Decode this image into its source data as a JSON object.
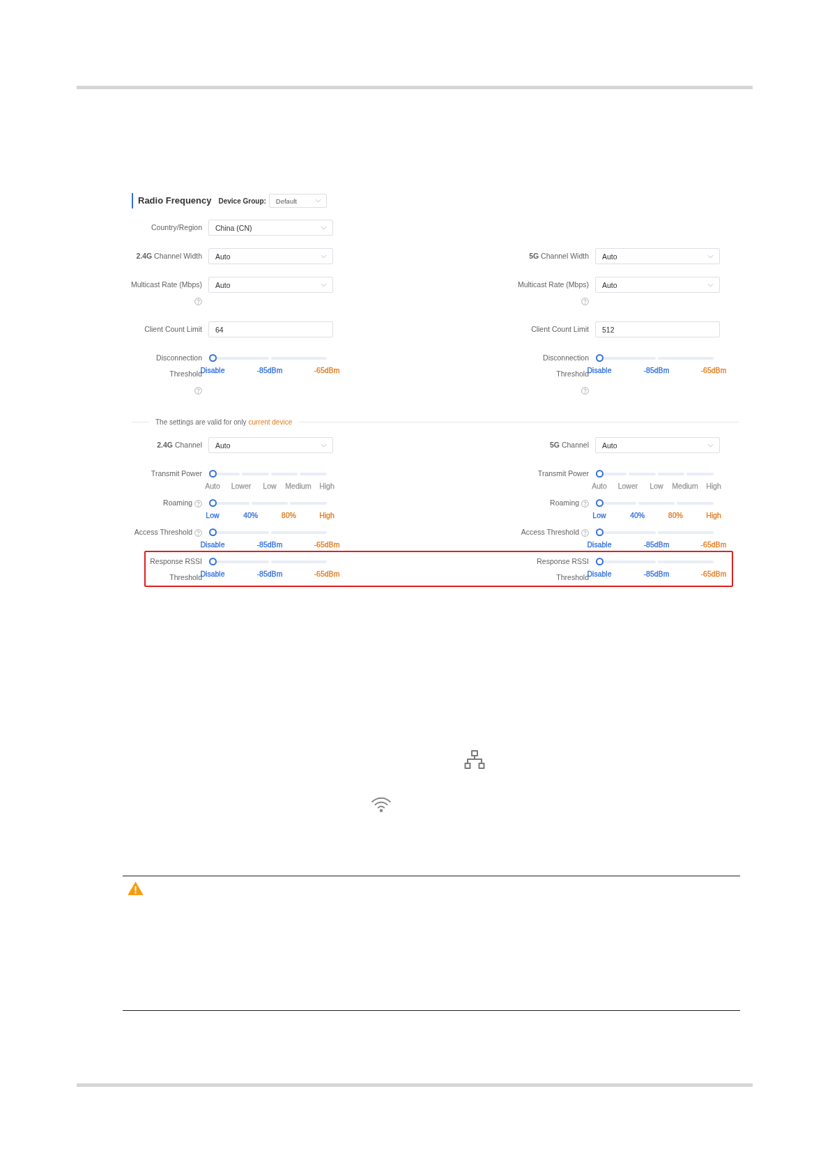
{
  "panel": {
    "title": "Radio Frequency",
    "device_group": {
      "label": "Device Group:",
      "value": "Default"
    }
  },
  "global_rows": [
    {
      "left": {
        "kind": "select",
        "label": "Country/Region",
        "value": "China (CN)"
      }
    },
    {
      "left": {
        "kind": "select",
        "label": "**2.4G** Channel Width",
        "value": "Auto"
      },
      "right": {
        "kind": "select",
        "label": "**5G** Channel Width",
        "value": "Auto"
      }
    },
    {
      "left": {
        "kind": "select",
        "label": "Multicast Rate (Mbps)",
        "value": "Auto",
        "help": true
      },
      "right": {
        "kind": "select",
        "label": "Multicast Rate (Mbps)",
        "value": "Auto",
        "help": true
      }
    },
    {
      "left": {
        "kind": "input",
        "label": "Client Count Limit",
        "value": "64"
      },
      "right": {
        "kind": "input",
        "label": "Client Count Limit",
        "value": "512"
      }
    },
    {
      "left": {
        "kind": "slider",
        "label": "Disconnection Threshold",
        "help": true,
        "level": 0,
        "ticks": [
          {
            "text": "Disable",
            "color": "#2f6fdc"
          },
          {
            "text": "-85dBm",
            "color": "#2f6fdc"
          },
          {
            "text": "-65dBm",
            "color": "#e07a1f"
          }
        ]
      },
      "right": {
        "kind": "slider",
        "label": "Disconnection Threshold",
        "help": true,
        "level": 0,
        "ticks": [
          {
            "text": "Disable",
            "color": "#2f6fdc"
          },
          {
            "text": "-85dBm",
            "color": "#2f6fdc"
          },
          {
            "text": "-65dBm",
            "color": "#e07a1f"
          }
        ]
      }
    }
  ],
  "device_note": {
    "text": "The settings are valid for only",
    "link": "current device"
  },
  "device_rows": [
    {
      "highlighted": false,
      "left": {
        "kind": "select",
        "label": "**2.4G** Channel",
        "value": "Auto"
      },
      "right": {
        "kind": "select",
        "label": "**5G** Channel",
        "value": "Auto"
      }
    },
    {
      "highlighted": false,
      "left": {
        "kind": "slider",
        "label": "Transmit Power",
        "level": 0,
        "ticks": [
          {
            "text": "Auto",
            "color": "#999999"
          },
          {
            "text": "Lower",
            "color": "#999999"
          },
          {
            "text": "Low",
            "color": "#999999"
          },
          {
            "text": "Medium",
            "color": "#999999"
          },
          {
            "text": "High",
            "color": "#999999"
          }
        ]
      },
      "right": {
        "kind": "slider",
        "label": "Transmit Power",
        "level": 0,
        "ticks": [
          {
            "text": "Auto",
            "color": "#999999"
          },
          {
            "text": "Lower",
            "color": "#999999"
          },
          {
            "text": "Low",
            "color": "#999999"
          },
          {
            "text": "Medium",
            "color": "#999999"
          },
          {
            "text": "High",
            "color": "#999999"
          }
        ]
      }
    },
    {
      "highlighted": false,
      "left": {
        "kind": "slider",
        "label": "Roaming",
        "help": true,
        "level": 0,
        "ticks": [
          {
            "text": "Low",
            "color": "#2f6fdc"
          },
          {
            "text": "40%",
            "color": "#2f6fdc"
          },
          {
            "text": "80%",
            "color": "#e07a1f"
          },
          {
            "text": "High",
            "color": "#e07a1f"
          }
        ]
      },
      "right": {
        "kind": "slider",
        "label": "Roaming",
        "help": true,
        "level": 0,
        "ticks": [
          {
            "text": "Low",
            "color": "#2f6fdc"
          },
          {
            "text": "40%",
            "color": "#2f6fdc"
          },
          {
            "text": "80%",
            "color": "#e07a1f"
          },
          {
            "text": "High",
            "color": "#e07a1f"
          }
        ]
      }
    },
    {
      "highlighted": false,
      "left": {
        "kind": "slider",
        "label": "Access Threshold",
        "help": true,
        "level": 0,
        "ticks": [
          {
            "text": "Disable",
            "color": "#2f6fdc"
          },
          {
            "text": "-85dBm",
            "color": "#2f6fdc"
          },
          {
            "text": "-65dBm",
            "color": "#e07a1f"
          }
        ]
      },
      "right": {
        "kind": "slider",
        "label": "Access Threshold",
        "help": true,
        "level": 0,
        "ticks": [
          {
            "text": "Disable",
            "color": "#2f6fdc"
          },
          {
            "text": "-85dBm",
            "color": "#2f6fdc"
          },
          {
            "text": "-65dBm",
            "color": "#e07a1f"
          }
        ]
      }
    },
    {
      "highlighted": true,
      "left": {
        "kind": "slider",
        "label": "Response RSSI Threshold",
        "level": 0,
        "ticks": [
          {
            "text": "Disable",
            "color": "#2f6fdc"
          },
          {
            "text": "-85dBm",
            "color": "#2f6fdc"
          },
          {
            "text": "-65dBm",
            "color": "#e07a1f"
          }
        ]
      },
      "right": {
        "kind": "slider",
        "label": "Response RSSI Threshold",
        "level": 0,
        "ticks": [
          {
            "text": "Disable",
            "color": "#2f6fdc"
          },
          {
            "text": "-85dBm",
            "color": "#2f6fdc"
          },
          {
            "text": "-65dBm",
            "color": "#e07a1f"
          }
        ]
      }
    }
  ]
}
